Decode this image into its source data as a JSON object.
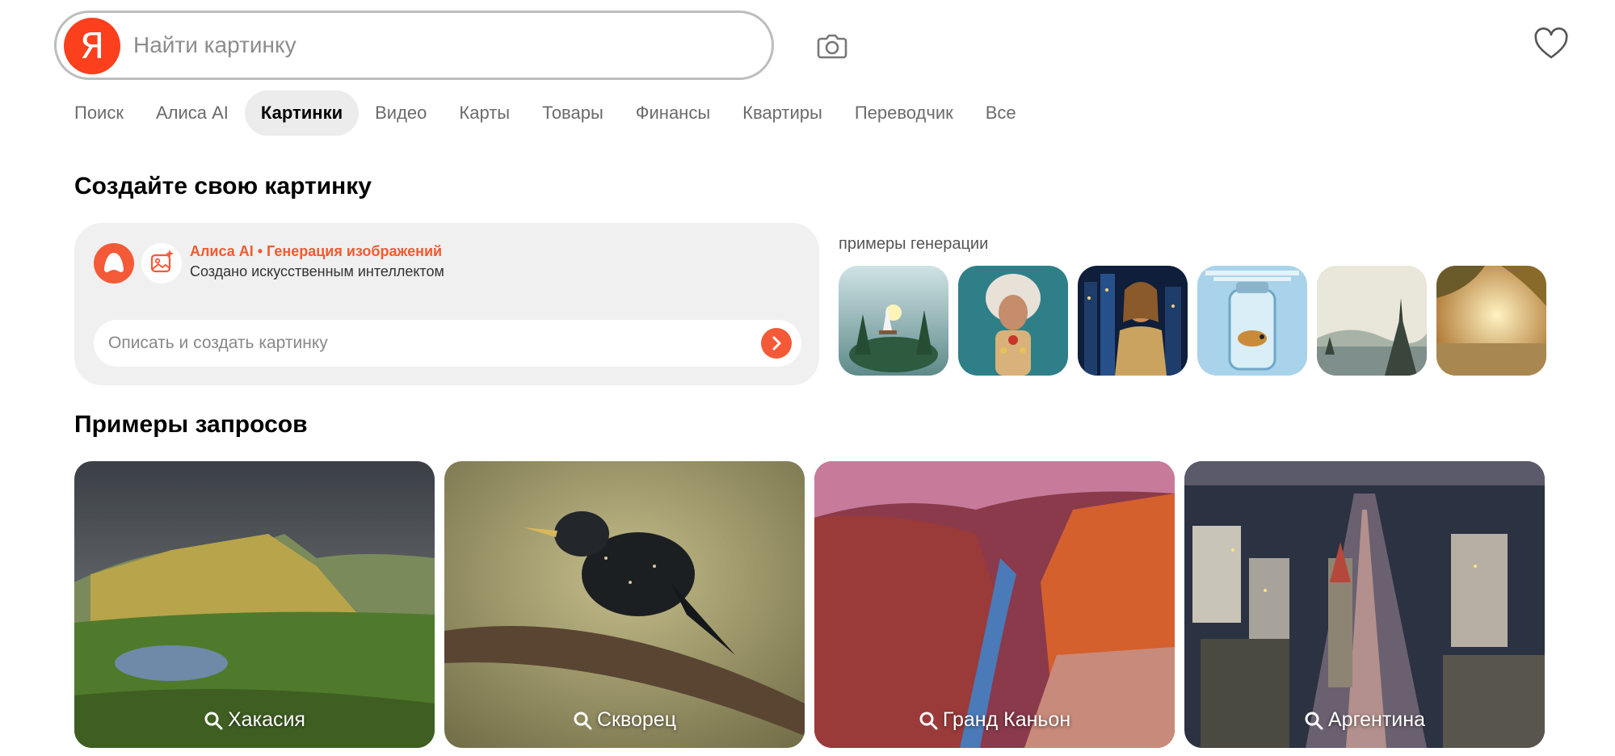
{
  "header": {
    "logo_letter": "Я",
    "search_placeholder": "Найти картинку",
    "camera_icon": "camera-icon",
    "favorites_icon": "heart-icon"
  },
  "nav": {
    "items": [
      "Поиск",
      "Алиса AI",
      "Картинки",
      "Видео",
      "Карты",
      "Товары",
      "Финансы",
      "Квартиры",
      "Переводчик",
      "Все"
    ],
    "active": "Картинки"
  },
  "create": {
    "heading": "Создайте свою картинку",
    "card_title": "Алиса AI • Генерация изображений",
    "card_subtitle": "Создано искусственным интеллектом",
    "input_placeholder": "Описать и создать картинку",
    "examples_label": "примеры генерации"
  },
  "queries": {
    "heading": "Примеры запросов",
    "items": [
      "Хакасия",
      "Скворец",
      "Гранд Каньон",
      "Аргентина"
    ]
  },
  "colors": {
    "brand_red": "#fc3f1d",
    "accent_orange": "#f45a37",
    "nav_active_bg": "#ececec"
  }
}
